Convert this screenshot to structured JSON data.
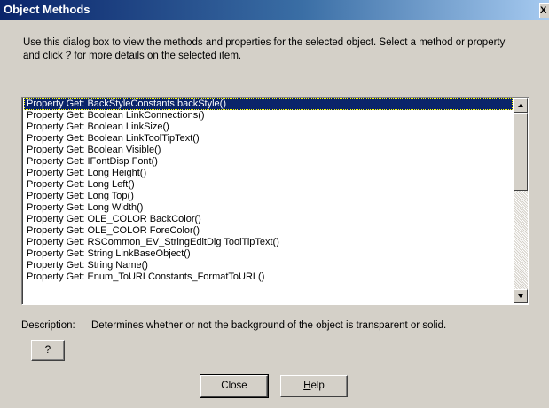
{
  "window": {
    "title": "Object Methods",
    "close_glyph": "X"
  },
  "intro_text": "Use this dialog box to view the methods and properties for the selected object.  Select a method or property and click ?  for more details on the selected item.",
  "methods_list": {
    "selected_index": 0,
    "items": [
      "Property Get: BackStyleConstants backStyle()",
      "Property Get: Boolean LinkConnections()",
      "Property Get: Boolean LinkSize()",
      "Property Get: Boolean LinkToolTipText()",
      "Property Get: Boolean Visible()",
      "Property Get: IFontDisp Font()",
      "Property Get: Long Height()",
      "Property Get: Long Left()",
      "Property Get: Long Top()",
      "Property Get: Long Width()",
      "Property Get: OLE_COLOR BackColor()",
      "Property Get: OLE_COLOR ForeColor()",
      "Property Get: RSCommon_EV_StringEditDlg ToolTipText()",
      "Property Get: String LinkBaseObject()",
      "Property Get: String Name()",
      "Property Get: Enum_ToURLConstants_FormatToURL()"
    ]
  },
  "description": {
    "label": "Description:",
    "text": "Determines whether or not the background of the object is transparent or solid."
  },
  "buttons": {
    "question": "?",
    "close": "Close",
    "help_prefix": "H",
    "help_rest": "elp"
  }
}
